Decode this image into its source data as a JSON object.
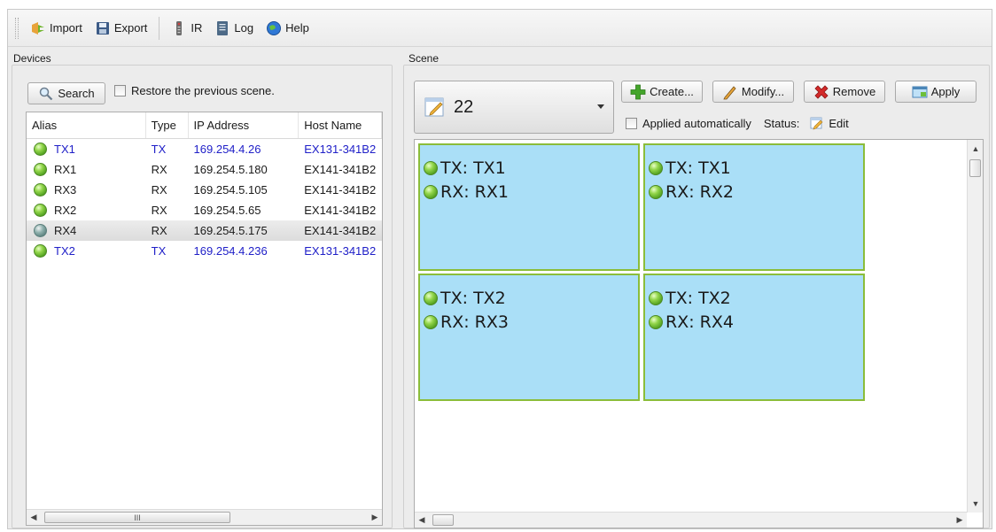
{
  "toolbar": {
    "import_label": "Import",
    "export_label": "Export",
    "ir_label": "IR",
    "log_label": "Log",
    "help_label": "Help"
  },
  "devices": {
    "title": "Devices",
    "search_label": "Search",
    "restore_label": "Restore the previous scene.",
    "columns": [
      "Alias",
      "Type",
      "IP Address",
      "Host Name"
    ],
    "rows": [
      {
        "alias": "TX1",
        "type": "TX",
        "ip": "169.254.4.26",
        "host": "EX131-341B2",
        "status": "online",
        "kind": "tx"
      },
      {
        "alias": "RX1",
        "type": "RX",
        "ip": "169.254.5.180",
        "host": "EX141-341B2",
        "status": "online",
        "kind": "rx"
      },
      {
        "alias": "RX3",
        "type": "RX",
        "ip": "169.254.5.105",
        "host": "EX141-341B2",
        "status": "online",
        "kind": "rx"
      },
      {
        "alias": "RX2",
        "type": "RX",
        "ip": "169.254.5.65",
        "host": "EX141-341B2",
        "status": "online",
        "kind": "rx"
      },
      {
        "alias": "RX4",
        "type": "RX",
        "ip": "169.254.5.175",
        "host": "EX141-341B2",
        "status": "idle",
        "kind": "rx",
        "selected": true
      },
      {
        "alias": "TX2",
        "type": "TX",
        "ip": "169.254.4.236",
        "host": "EX131-341B2",
        "status": "online",
        "kind": "tx"
      }
    ],
    "scroll_grip": "III"
  },
  "scene": {
    "title": "Scene",
    "selected_scene": "22",
    "create_label": "Create...",
    "modify_label": "Modify...",
    "remove_label": "Remove",
    "apply_label": "Apply",
    "auto_label": "Applied automatically",
    "status_label": "Status:",
    "status_value": "Edit",
    "tiles": [
      {
        "tx": "TX: TX1",
        "rx": "RX: RX1"
      },
      {
        "tx": "TX: TX1",
        "rx": "RX: RX2"
      },
      {
        "tx": "TX: TX2",
        "rx": "RX: RX3"
      },
      {
        "tx": "TX: TX2",
        "rx": "RX: RX4"
      }
    ]
  },
  "colors": {
    "tx_text": "#2020c8",
    "tile_fill": "#aadff7",
    "tile_border": "#8bbd3a",
    "status_online": "#62b32a"
  },
  "icons": {
    "import": "import-icon",
    "export": "floppy-disk-icon",
    "ir": "ir-remote-icon",
    "log": "log-book-icon",
    "help": "help-globe-icon",
    "search": "magnifier-icon",
    "create": "plus-icon",
    "modify": "pencil-icon",
    "remove": "red-x-icon",
    "apply": "apply-icon",
    "scene": "edit-scene-icon"
  }
}
